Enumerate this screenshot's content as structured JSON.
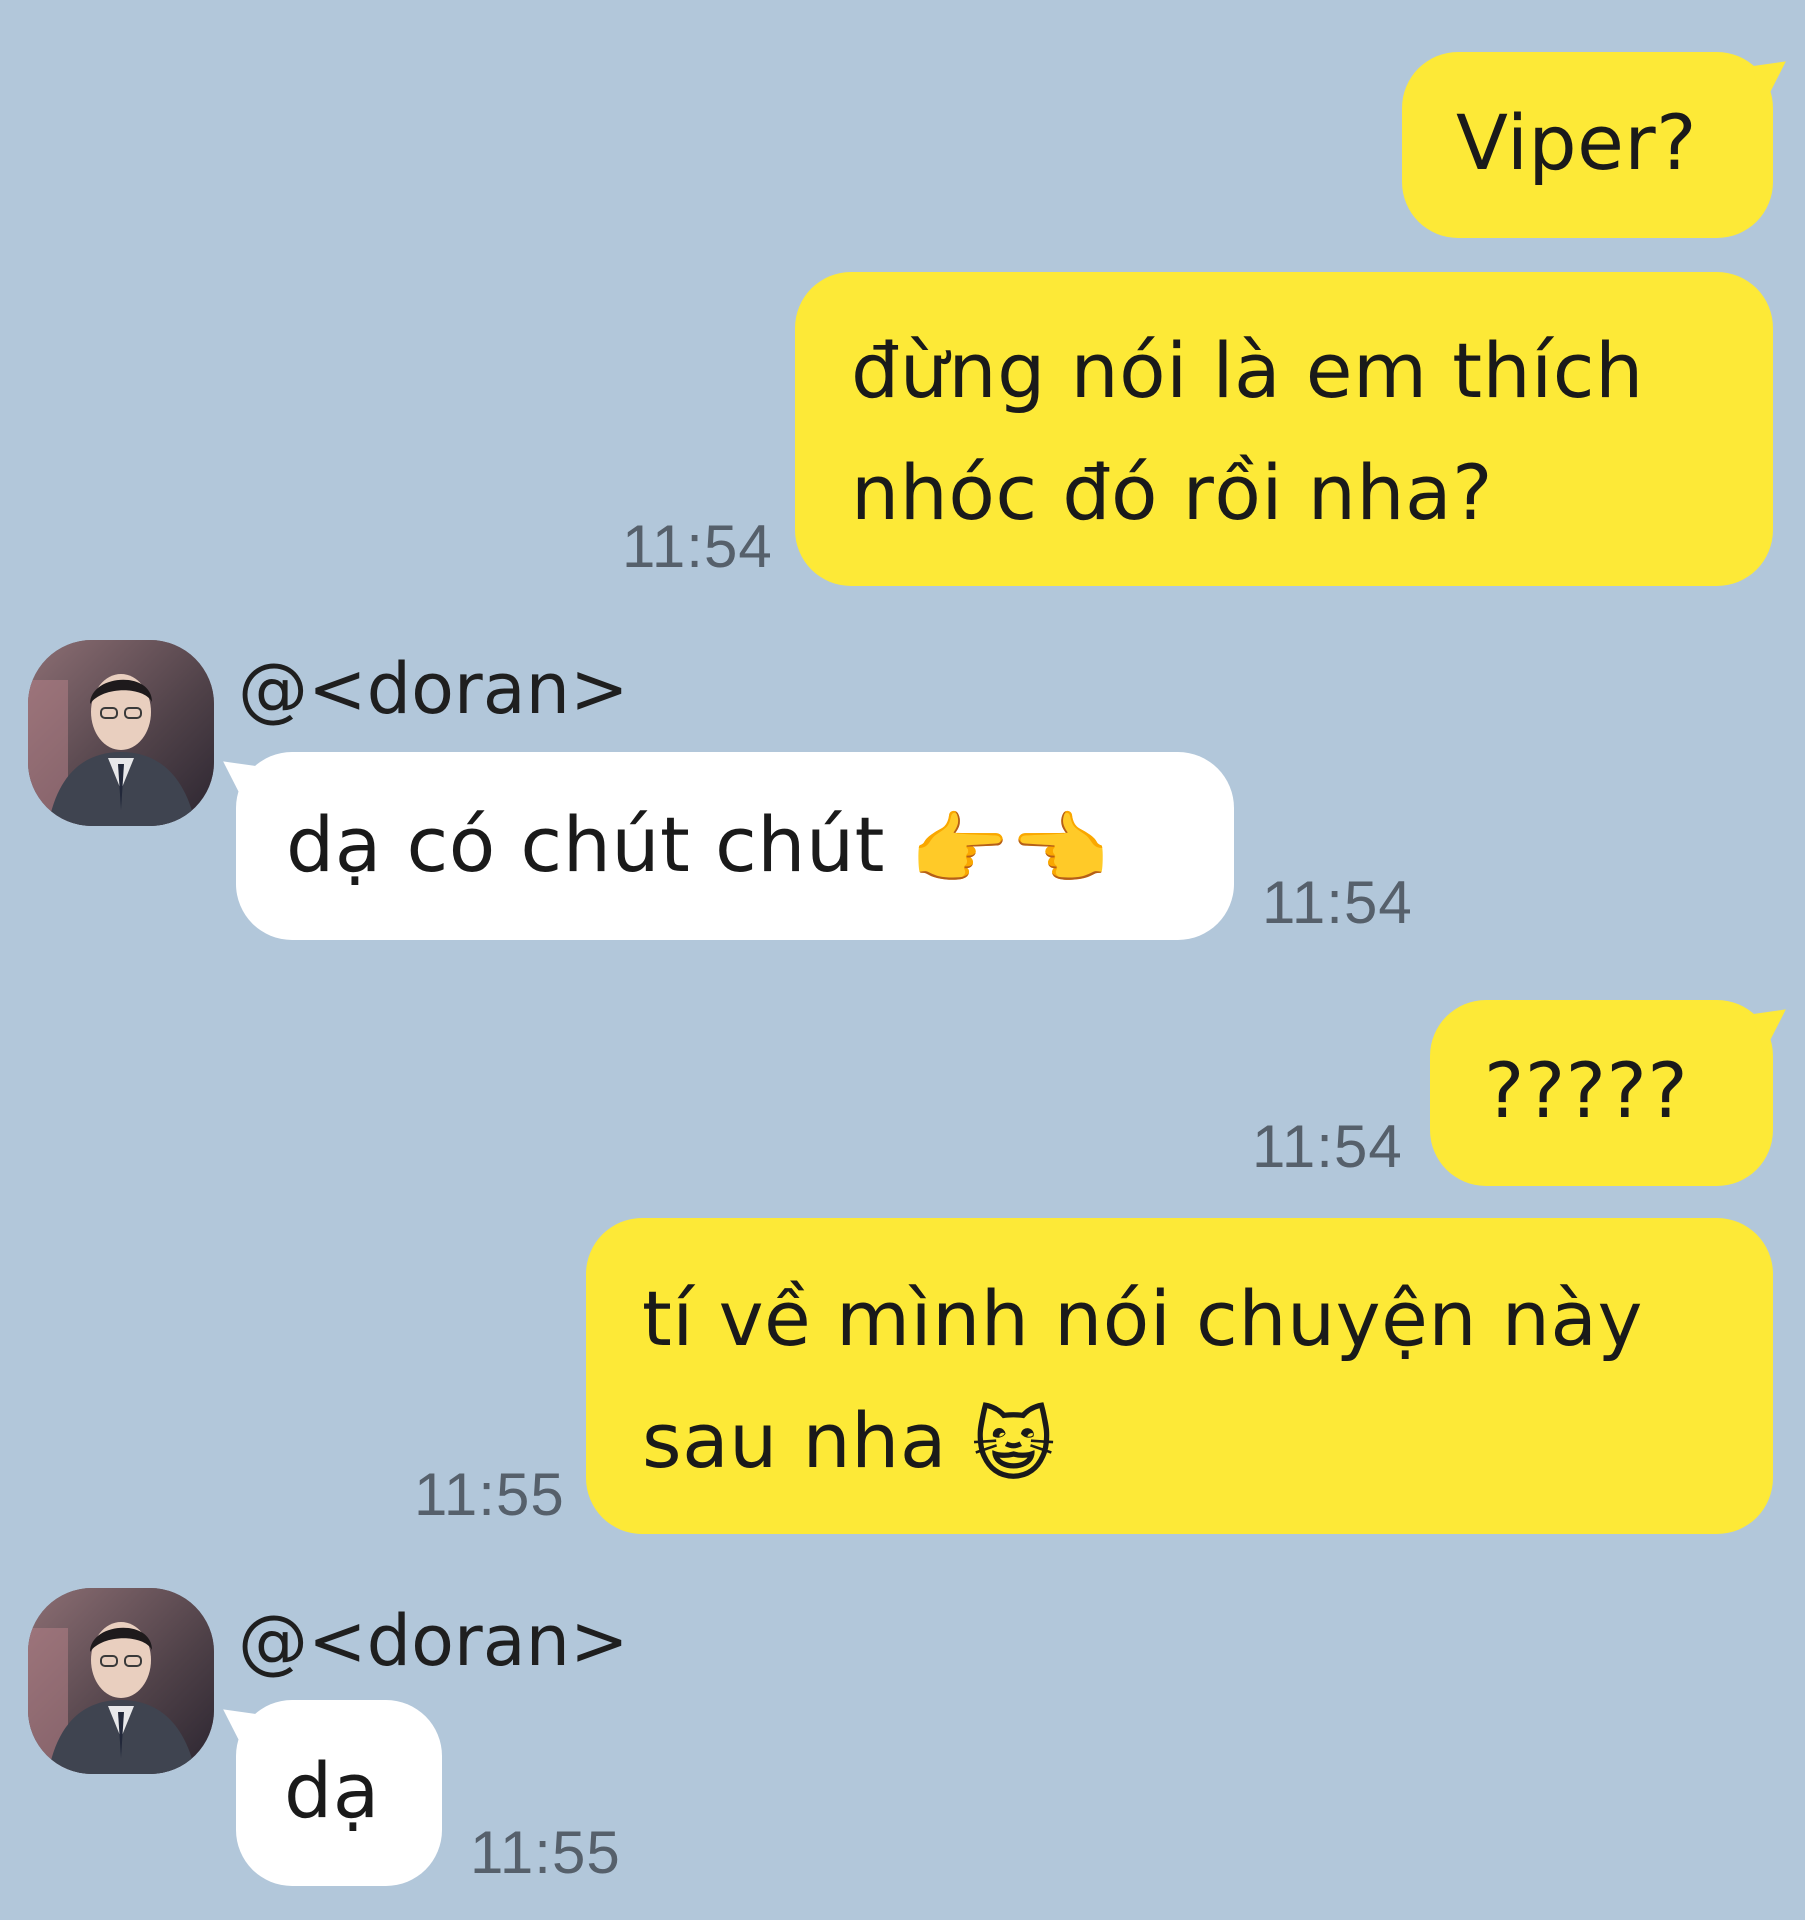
{
  "theme": {
    "background": "#b2c7da",
    "my_bubble": "#fde937",
    "their_bubble": "#ffffff"
  },
  "messages": [
    {
      "sender": "me",
      "text": "Viper?"
    },
    {
      "sender": "me",
      "text": "đừng nói là em thích\nnhóc đó rồi nha?",
      "time": "11:54"
    },
    {
      "sender": "contact",
      "name": "@<doran>",
      "text": "dạ có chút chút",
      "emoji": "👉👈",
      "time": "11:54",
      "avatar_icon": "profile-photo"
    },
    {
      "sender": "me",
      "text": "?????",
      "time": "11:54"
    },
    {
      "sender": "me",
      "text": "tí về mình nói chuyện này\nsau nha",
      "emoji": "😺",
      "time": "11:55"
    },
    {
      "sender": "contact",
      "name": "@<doran>",
      "text": "dạ",
      "time": "11:55",
      "avatar_icon": "profile-photo"
    }
  ]
}
